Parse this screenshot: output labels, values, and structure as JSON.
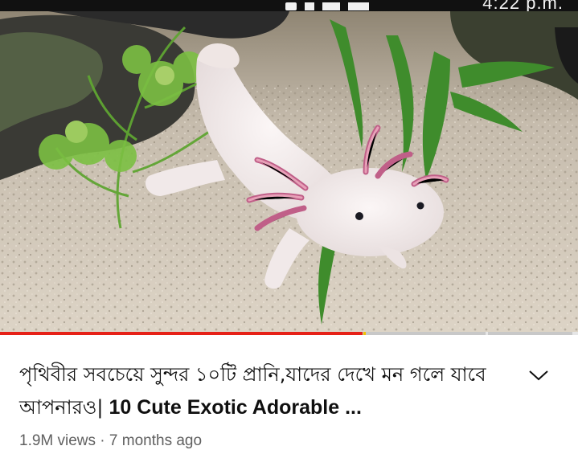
{
  "status_bar": {
    "clock": "4:22 p.m."
  },
  "player": {
    "thumbnail_alt": "axolotl",
    "progress_played": 0.627,
    "progress_buffered": 0.99,
    "colors": {
      "played": "#e62117",
      "buffered": "#c8c8c8",
      "marker": "#f2c200"
    }
  },
  "video": {
    "title_bengali": "পৃথিবীর সবচেয়ে সুন্দর ১০টি প্রানি,যাদের দেখে মন গলে যাবে আপনারও|",
    "title_english": " 10 Cute Exotic Adorable ...",
    "views": "1.9M views",
    "separator": " · ",
    "age": "7 months ago"
  },
  "icons": {
    "expand": "chevron-down-icon"
  }
}
